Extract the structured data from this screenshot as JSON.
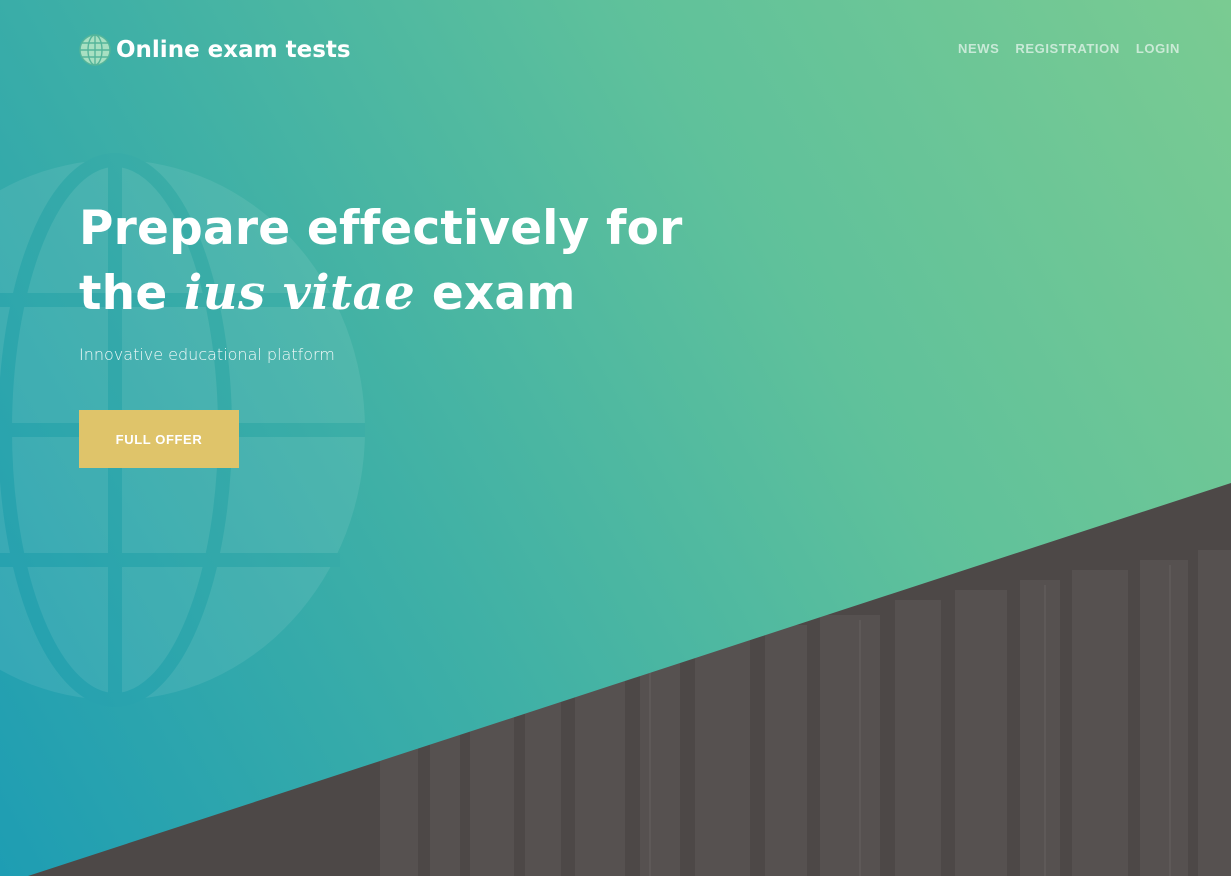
{
  "header": {
    "brand_name": "Online exam tests",
    "brand_icon": "globe-icon",
    "nav": [
      {
        "label": "NEWS"
      },
      {
        "label": "REGISTRATION"
      },
      {
        "label": "LOGIN"
      }
    ]
  },
  "hero": {
    "headline_line1": "Prepare effectively for",
    "headline_pre": "the ",
    "headline_emphasis": "ius vitae",
    "headline_post": " exam",
    "subtitle": "Innovative educational platform",
    "cta_label": "FULL OFFER"
  },
  "colors": {
    "gradient_start": "#1e9db3",
    "gradient_end": "#7acb92",
    "cta_background": "#dfc46a",
    "dark_background": "#4a4645",
    "text": "#ffffff"
  }
}
